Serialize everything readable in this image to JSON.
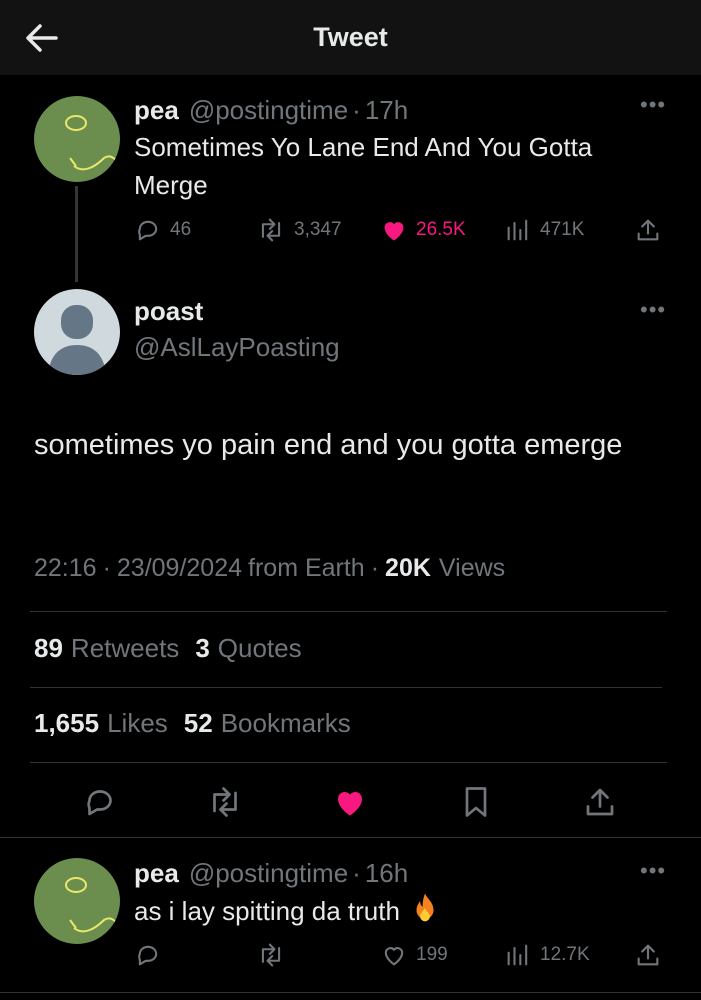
{
  "header": {
    "title": "Tweet"
  },
  "parent_tweet": {
    "name": "pea",
    "handle": "@postingtime",
    "time": "17h",
    "text": "Sometimes Yo Lane End And You Gotta Merge",
    "replies": "46",
    "retweets": "3,347",
    "likes": "26.5K",
    "views": "471K"
  },
  "main_tweet": {
    "name": "poast",
    "handle": "@AslLayPoasting",
    "text": "sometimes yo pain end and you gotta emerge",
    "time": "22:16",
    "date": "23/09/2024",
    "source": "from Earth",
    "views_count": "20K",
    "views_label": "Views",
    "retweets_count": "89",
    "retweets_label": "Retweets",
    "quotes_count": "3",
    "quotes_label": "Quotes",
    "likes_count": "1,655",
    "likes_label": "Likes",
    "bookmarks_count": "52",
    "bookmarks_label": "Bookmarks"
  },
  "reply_tweet": {
    "name": "pea",
    "handle": "@postingtime",
    "time": "16h",
    "text": "as i lay spitting da truth",
    "likes": "199",
    "views": "12.7K"
  },
  "colors": {
    "like": "#f91880",
    "muted": "#71767b",
    "avatar_green": "#6b8e4e"
  }
}
